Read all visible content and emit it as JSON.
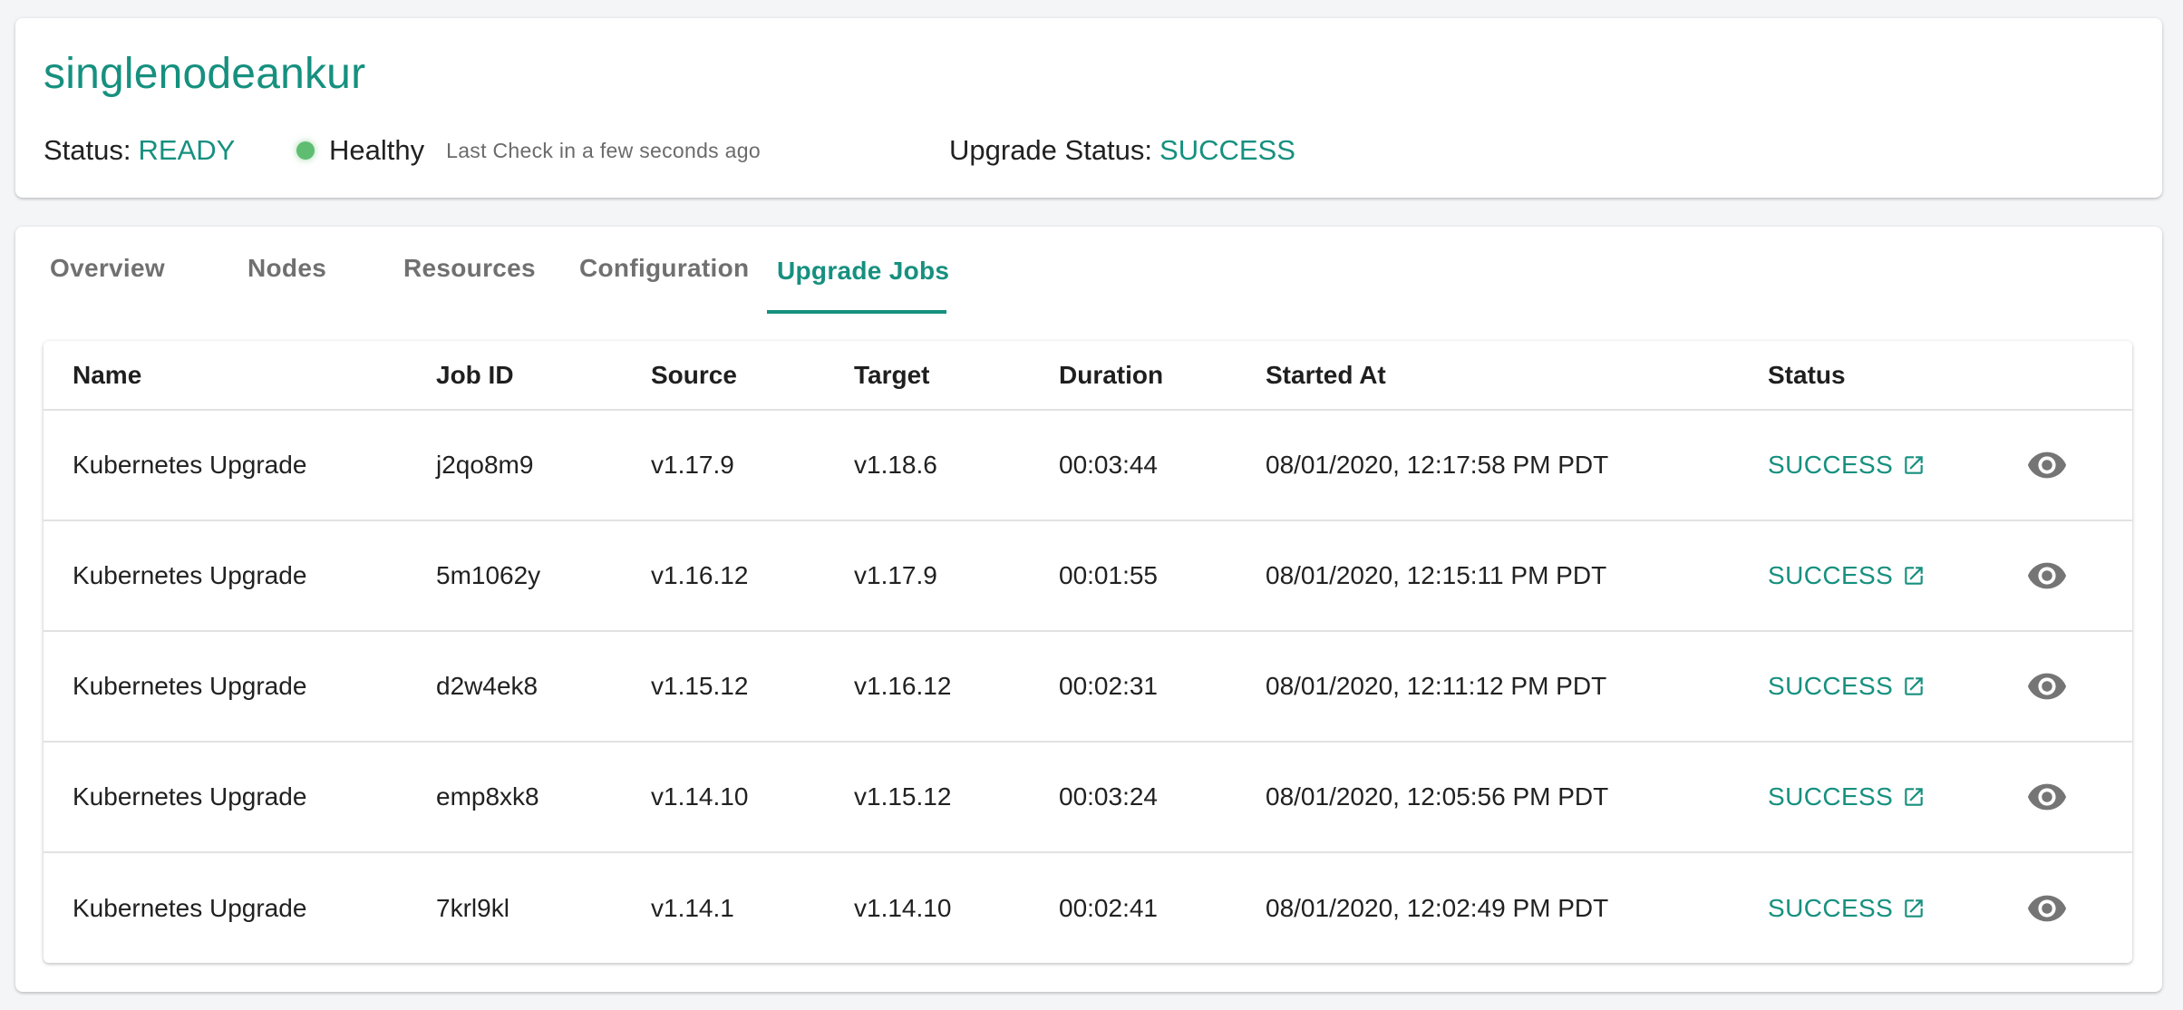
{
  "cluster": {
    "name": "singlenodeankur",
    "status_label": "Status:",
    "status_value": "READY",
    "health_label": "Healthy",
    "last_check": "Last Check in a few seconds ago",
    "upgrade_status_label": "Upgrade Status:",
    "upgrade_status_value": "SUCCESS"
  },
  "tabs": [
    {
      "label": "Overview"
    },
    {
      "label": "Nodes"
    },
    {
      "label": "Resources"
    },
    {
      "label": "Configuration"
    },
    {
      "label": "Upgrade Jobs",
      "active": true
    }
  ],
  "table": {
    "columns": [
      "Name",
      "Job ID",
      "Source",
      "Target",
      "Duration",
      "Started At",
      "Status"
    ],
    "rows": [
      {
        "name": "Kubernetes Upgrade",
        "job_id": "j2qo8m9",
        "source": "v1.17.9",
        "target": "v1.18.6",
        "duration": "00:03:44",
        "started_at": "08/01/2020, 12:17:58 PM PDT",
        "status": "SUCCESS"
      },
      {
        "name": "Kubernetes Upgrade",
        "job_id": "5m1062y",
        "source": "v1.16.12",
        "target": "v1.17.9",
        "duration": "00:01:55",
        "started_at": "08/01/2020, 12:15:11 PM PDT",
        "status": "SUCCESS"
      },
      {
        "name": "Kubernetes Upgrade",
        "job_id": "d2w4ek8",
        "source": "v1.15.12",
        "target": "v1.16.12",
        "duration": "00:02:31",
        "started_at": "08/01/2020, 12:11:12 PM PDT",
        "status": "SUCCESS"
      },
      {
        "name": "Kubernetes Upgrade",
        "job_id": "emp8xk8",
        "source": "v1.14.10",
        "target": "v1.15.12",
        "duration": "00:03:24",
        "started_at": "08/01/2020, 12:05:56 PM PDT",
        "status": "SUCCESS"
      },
      {
        "name": "Kubernetes Upgrade",
        "job_id": "7krl9kl",
        "source": "v1.14.1",
        "target": "v1.14.10",
        "duration": "00:02:41",
        "started_at": "08/01/2020, 12:02:49 PM PDT",
        "status": "SUCCESS"
      }
    ]
  },
  "icons": {
    "status_link": "open-in-new-icon",
    "row_action": "eye-icon",
    "health": "health-dot-icon"
  },
  "colors": {
    "accent": "#16907f",
    "healthy": "#5fbd72",
    "icon_gray": "#757575"
  }
}
